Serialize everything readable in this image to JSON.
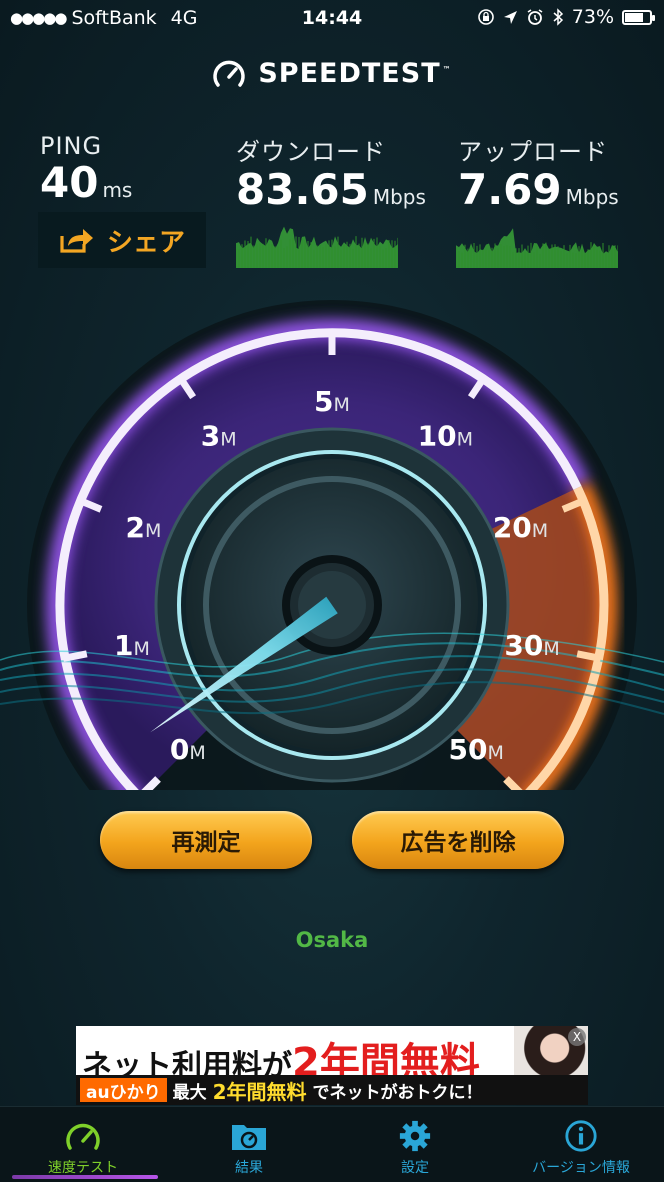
{
  "status_bar": {
    "carrier": "SoftBank",
    "network": "4G",
    "time": "14:44",
    "battery": "73%",
    "battery_level": 0.73
  },
  "brand": {
    "name": "SPEEDTEST",
    "tm": "™"
  },
  "ping": {
    "label": "PING",
    "value": "40",
    "unit": "ms"
  },
  "download": {
    "label": "ダウンロード",
    "value": "83.65",
    "unit": "Mbps"
  },
  "upload": {
    "label": "アップロード",
    "value": "7.69",
    "unit": "Mbps"
  },
  "share": {
    "label": "シェア"
  },
  "gauge": {
    "ticks": [
      {
        "value": "0",
        "unit": "M"
      },
      {
        "value": "1",
        "unit": "M"
      },
      {
        "value": "2",
        "unit": "M"
      },
      {
        "value": "3",
        "unit": "M"
      },
      {
        "value": "5",
        "unit": "M"
      },
      {
        "value": "10",
        "unit": "M"
      },
      {
        "value": "20",
        "unit": "M"
      },
      {
        "value": "30",
        "unit": "M"
      },
      {
        "value": "50",
        "unit": "M"
      }
    ]
  },
  "buttons": {
    "retest": "再測定",
    "remove_ads": "広告を削除"
  },
  "location": "Osaka",
  "ad": {
    "line1_a": "ネット利用料が",
    "line1_b": "2年間無料",
    "brand": "auひかり",
    "line2_a": "最大",
    "line2_b": "2年間無料",
    "line2_c": "でネットがおトクに！",
    "close": "X"
  },
  "tabs": [
    {
      "label": "速度テスト",
      "icon": "speedometer-icon"
    },
    {
      "label": "結果",
      "icon": "results-folder-icon"
    },
    {
      "label": "設定",
      "icon": "gear-icon"
    },
    {
      "label": "バージョン情報",
      "icon": "info-icon"
    }
  ],
  "colors": {
    "accent_orange": "#f3a623",
    "gauge_purple": "#8a54d8",
    "gauge_orange": "#f07a1a",
    "location_green": "#52b846",
    "tab_blue": "#2aa6d6",
    "tab_active_green": "#7fd02a"
  }
}
